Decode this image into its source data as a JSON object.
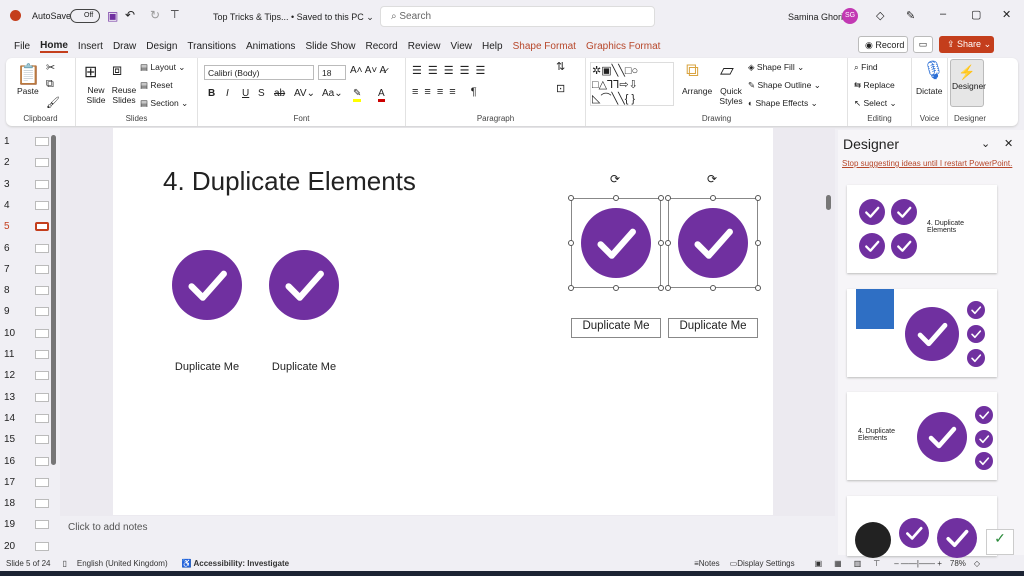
{
  "titlebar": {
    "autosave": "AutoSave",
    "toggle": "Off",
    "doc": "Top Tricks & Tips...  •  Saved to this PC ⌄",
    "search_placeholder": "Search",
    "user": "Samina Ghori",
    "initials": "SG"
  },
  "tabs": [
    "File",
    "Home",
    "Insert",
    "Draw",
    "Design",
    "Transitions",
    "Animations",
    "Slide Show",
    "Record",
    "Review",
    "View",
    "Help",
    "Shape Format",
    "Graphics Format"
  ],
  "actions": {
    "record": "Record",
    "share": "Share"
  },
  "ribbon": {
    "clipboard": {
      "label": "Clipboard",
      "paste": "Paste"
    },
    "slides": {
      "label": "Slides",
      "new": "New Slide",
      "reuse": "Reuse Slides",
      "layout": "Layout",
      "reset": "Reset",
      "section": "Section"
    },
    "font": {
      "label": "Font",
      "name": "Calibri (Body)",
      "size": "18"
    },
    "paragraph": {
      "label": "Paragraph"
    },
    "drawing": {
      "label": "Drawing",
      "arrange": "Arrange",
      "quick": "Quick Styles",
      "fill": "Shape Fill",
      "outline": "Shape Outline",
      "effects": "Shape Effects"
    },
    "editing": {
      "label": "Editing",
      "find": "Find",
      "replace": "Replace",
      "select": "Select"
    },
    "voice": {
      "label": "Voice",
      "dictate": "Dictate"
    },
    "designer": {
      "label": "Designer",
      "btn": "Designer"
    }
  },
  "thumbs": [
    "1",
    "2",
    "3",
    "4",
    "5",
    "6",
    "7",
    "8",
    "9",
    "10",
    "11",
    "12",
    "13",
    "14",
    "15",
    "16",
    "17",
    "18",
    "19",
    "20"
  ],
  "slide": {
    "title": "4. Duplicate Elements",
    "caption": "Duplicate Me",
    "accent": "#7030a0"
  },
  "notes": "Click to add notes",
  "designer": {
    "title": "Designer",
    "link": "Stop suggesting ideas until I restart PowerPoint.",
    "card1": "4. Duplicate Elements",
    "card3": "4. Duplicate Elements"
  },
  "status": {
    "slide": "Slide 5 of 24",
    "lang": "English (United Kingdom)",
    "access": "Accessibility: Investigate",
    "notes": "Notes",
    "display": "Display Settings",
    "zoom": "78%"
  }
}
